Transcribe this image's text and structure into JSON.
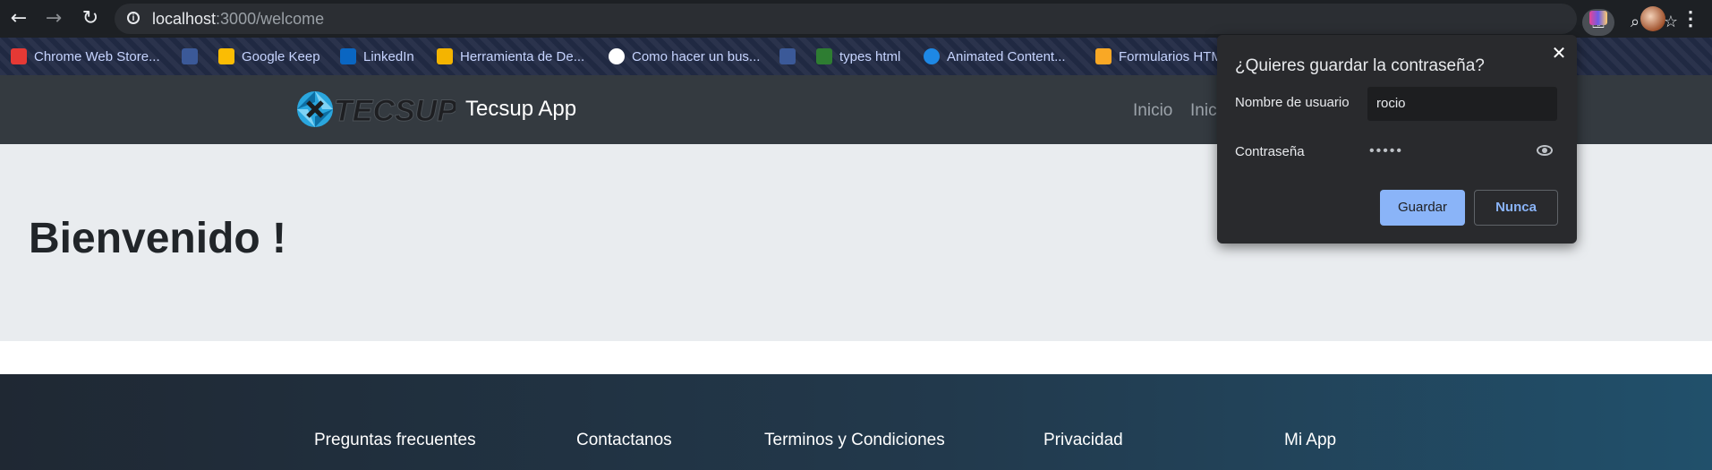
{
  "browser": {
    "url_host": "localhost",
    "url_rest": ":3000/welcome",
    "icons": [
      "back-icon",
      "forward-icon",
      "reload-icon",
      "info-icon",
      "key-icon",
      "zoom-icon",
      "star-icon",
      "extension-icon",
      "profile-avatar",
      "menu-icon"
    ]
  },
  "bookmarks": [
    {
      "label": "Chrome Web Store...",
      "icon": "chrome-store-icon",
      "color": "#e53935"
    },
    {
      "label": "",
      "icon": "facebook-icon",
      "color": "#3b5998"
    },
    {
      "label": "Google Keep",
      "icon": "keep-icon",
      "color": "#fbbc04"
    },
    {
      "label": "LinkedIn",
      "icon": "linkedin-icon",
      "color": "#0a66c2"
    },
    {
      "label": "Herramienta de De...",
      "icon": "code-icon",
      "color": "#f4b400"
    },
    {
      "label": "Como hacer un bus...",
      "icon": "globe-icon",
      "color": "#ffffff"
    },
    {
      "label": "",
      "icon": "facebook-icon",
      "color": "#3b5998"
    },
    {
      "label": "types html",
      "icon": "check-icon",
      "color": "#2e7d32"
    },
    {
      "label": "Animated Content...",
      "icon": "drop-icon",
      "color": "#1e88e5"
    },
    {
      "label": "Formularios HTM",
      "icon": "form-icon",
      "color": "#f9a825"
    }
  ],
  "app": {
    "brand": "Tecsup App",
    "logo_text": "TECSUP",
    "nav": [
      "Inicio",
      "Inic"
    ],
    "heading": "Bienvenido !",
    "footer_links": [
      "Preguntas frecuentes",
      "Contactanos",
      "Terminos y Condiciones",
      "Privacidad",
      "Mi App"
    ]
  },
  "password_popup": {
    "title": "¿Quieres guardar la contraseña?",
    "close": "✕",
    "username_label": "Nombre de usuario",
    "username_value": "rocio",
    "password_label": "Contraseña",
    "password_masked": "•••••",
    "save_label": "Guardar",
    "never_label": "Nunca"
  },
  "colors": {
    "browser_bar": "#1d2024",
    "navbar": "#343a40",
    "jumbotron": "#e9ecef",
    "accent": "#8ab4f8"
  }
}
